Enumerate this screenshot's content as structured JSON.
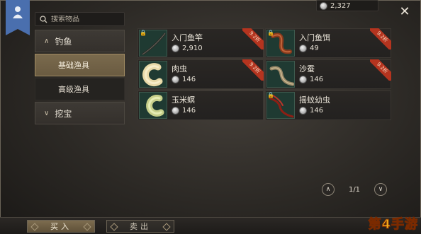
{
  "search": {
    "placeholder": "搜索物品"
  },
  "currency": {
    "amount": "2,327"
  },
  "sidebar": {
    "categories": [
      {
        "label": "钓鱼",
        "expanded": true,
        "items": [
          {
            "label": "基础渔具",
            "active": true
          },
          {
            "label": "高级渔具",
            "active": false
          }
        ]
      },
      {
        "label": "挖宝",
        "expanded": false,
        "items": []
      }
    ]
  },
  "items": [
    {
      "name": "入门鱼竿",
      "price": "2,910",
      "discount": "9.2折",
      "icon": "fishing-rod-icon"
    },
    {
      "name": "入门鱼饵",
      "price": "49",
      "discount": "9.2折",
      "icon": "worm-bait-icon"
    },
    {
      "name": "肉虫",
      "price": "146",
      "discount": "9.2折",
      "icon": "grub-icon"
    },
    {
      "name": "沙蚕",
      "price": "146",
      "discount": "9.2折",
      "icon": "sandworm-icon"
    },
    {
      "name": "玉米螟",
      "price": "146",
      "discount": "9.2折",
      "icon": "corn-borer-icon"
    },
    {
      "name": "摇蚊幼虫",
      "price": "146",
      "discount": "9.2折",
      "icon": "bloodworm-icon"
    }
  ],
  "pager": {
    "label": "1/1"
  },
  "bottom": {
    "buy": "买入",
    "sell": "卖出"
  },
  "watermark": {
    "text": "第4手游"
  },
  "colors": {
    "accent_gold": "#7d6c4f",
    "discount_red": "#b5341f",
    "bookmark_blue": "#4a6fae"
  }
}
